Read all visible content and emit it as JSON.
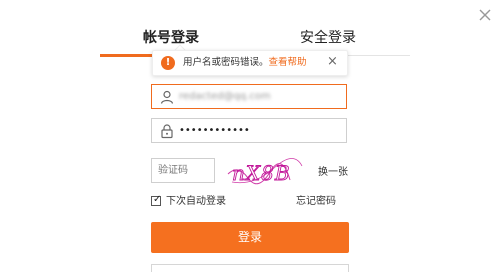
{
  "dialog": {
    "close_icon": "close-icon",
    "accent_color": "#f06b1e"
  },
  "tabs": [
    {
      "label": "帐号登录",
      "active": true
    },
    {
      "label": "安全登录",
      "active": false
    }
  ],
  "error_tooltip": {
    "icon": "warning-icon",
    "icon_glyph": "!",
    "message": "用户名或密码错误。",
    "help_link": "查看帮助",
    "close_glyph": "×"
  },
  "form": {
    "username": {
      "icon": "user-icon",
      "value": "redacted@qq.com"
    },
    "password": {
      "icon": "lock-icon",
      "value": "••••••••••••"
    },
    "captcha": {
      "placeholder": "验证码",
      "image_text": "nX8B"
    },
    "refresh_label": "换一张",
    "remember": {
      "label": "下次自动登录",
      "checked": true,
      "check_glyph": "✓"
    },
    "forgot_label": "忘记密码",
    "submit_label": "登录"
  }
}
